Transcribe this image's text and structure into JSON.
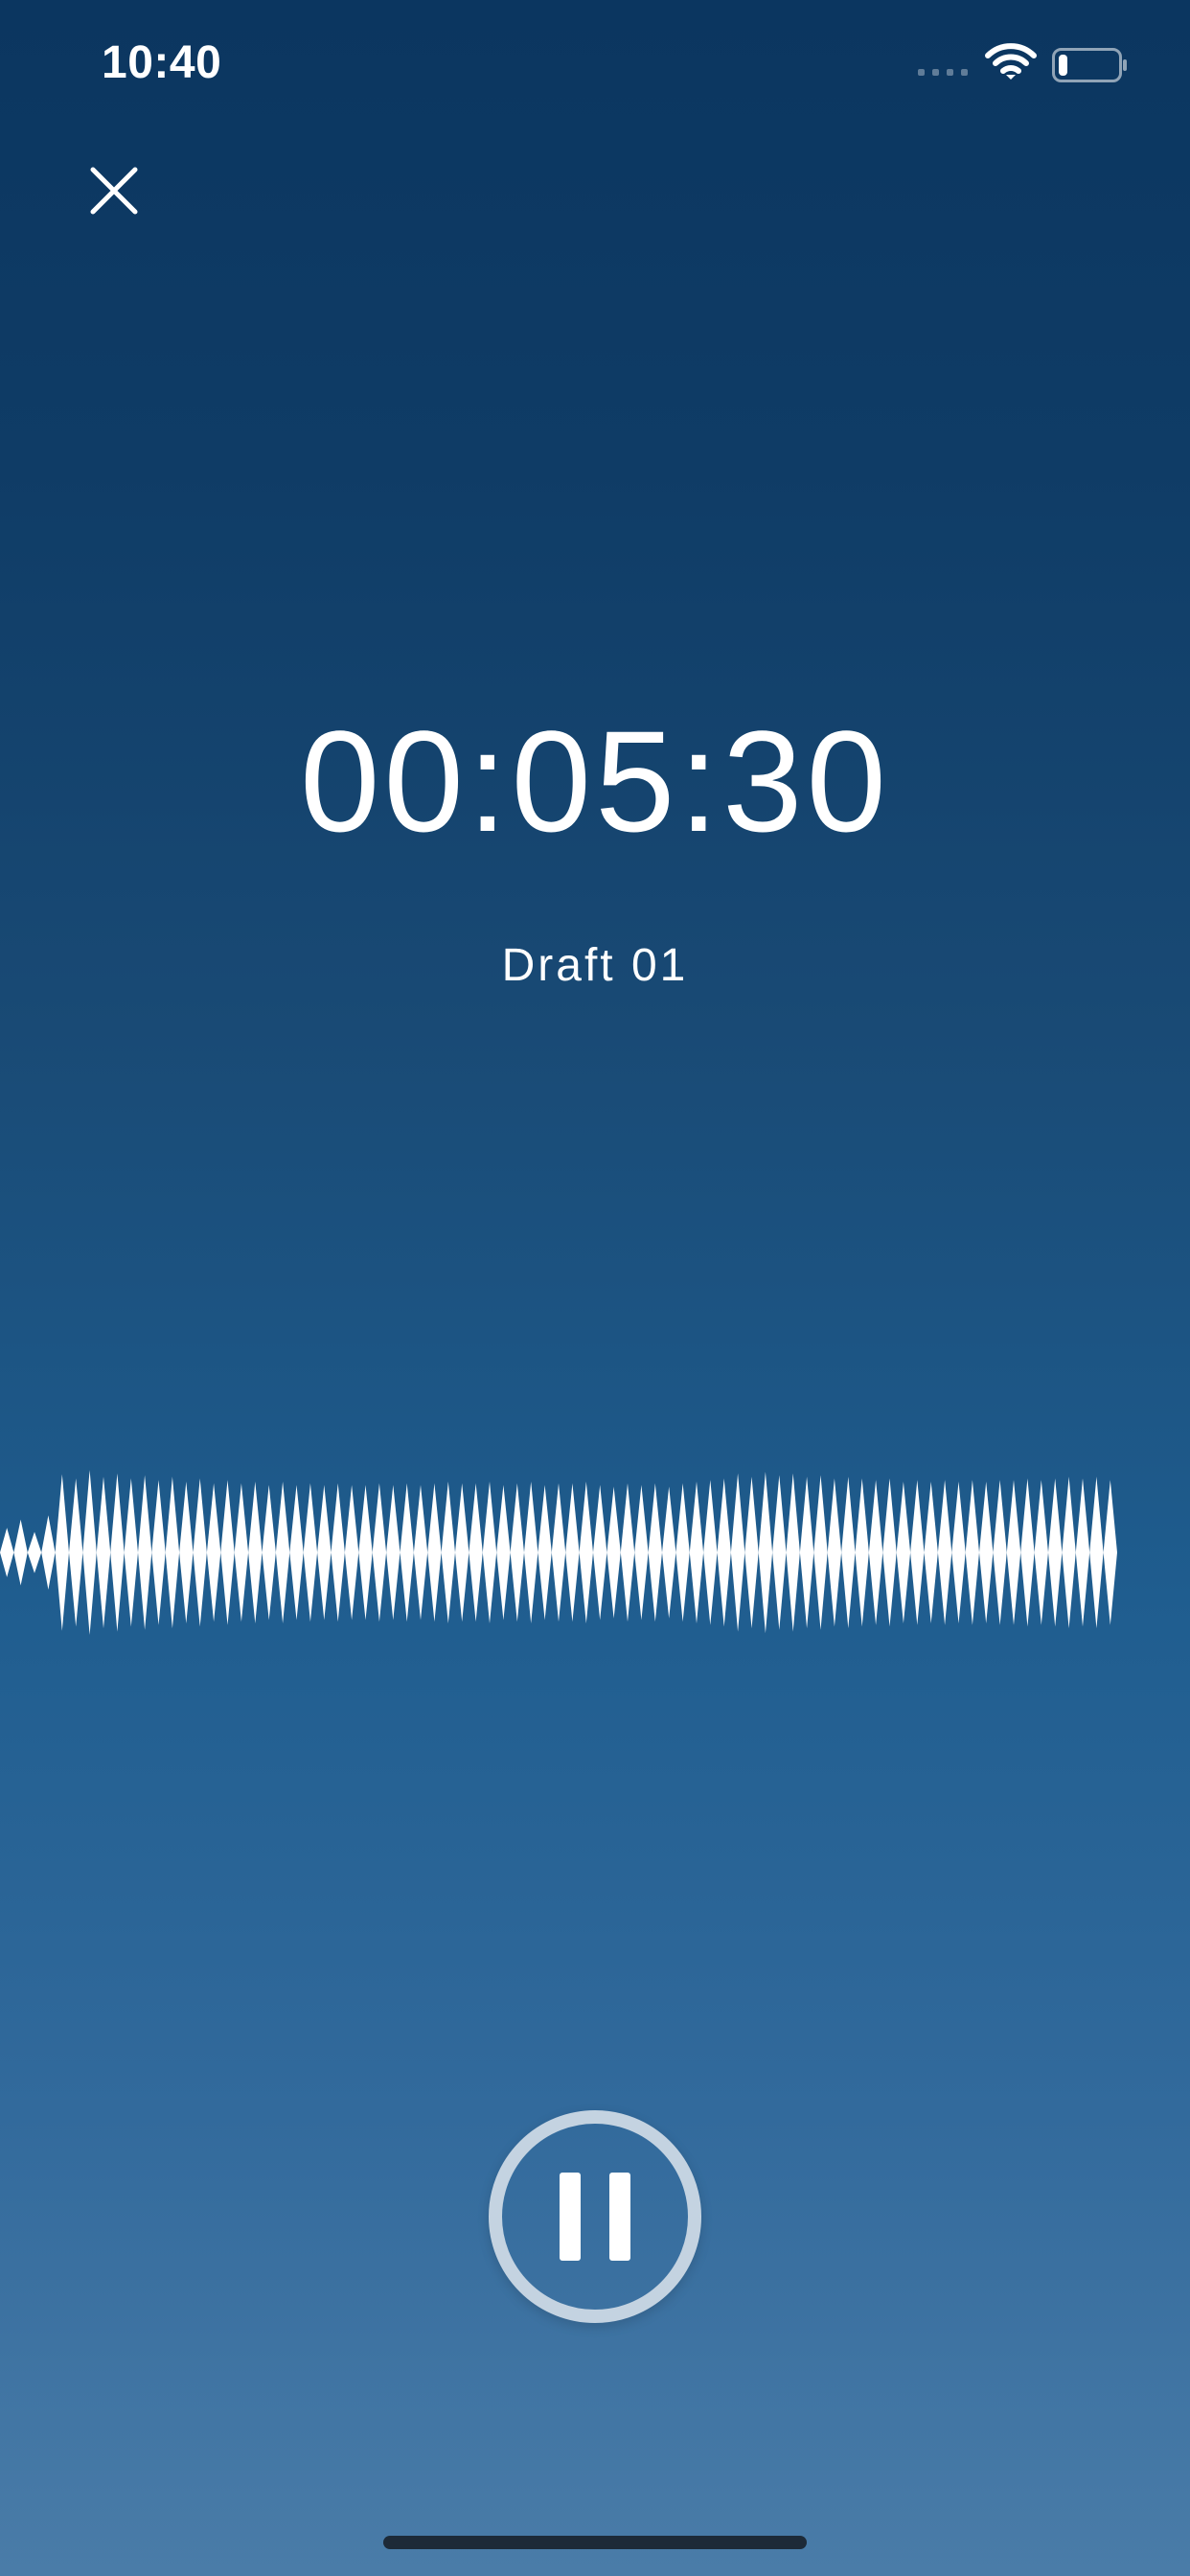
{
  "status_bar": {
    "time": "10:40",
    "icons": [
      "cellular-signal-icon",
      "wifi-icon",
      "battery-icon"
    ],
    "battery_level": 0.15
  },
  "toolbar": {
    "close_icon": "close-icon"
  },
  "recording": {
    "elapsed_time": "00:05:30",
    "title": "Draft 01",
    "state": "recording",
    "waveform_amplitudes": [
      0.3,
      0.4,
      0.25,
      0.45,
      0.95,
      0.9,
      1.0,
      0.92,
      0.96,
      0.9,
      0.94,
      0.88,
      0.92,
      0.86,
      0.9,
      0.84,
      0.88,
      0.84,
      0.86,
      0.82,
      0.86,
      0.82,
      0.84,
      0.82,
      0.84,
      0.82,
      0.82,
      0.84,
      0.82,
      0.84,
      0.82,
      0.84,
      0.86,
      0.84,
      0.84,
      0.86,
      0.82,
      0.84,
      0.86,
      0.82,
      0.84,
      0.84,
      0.86,
      0.82,
      0.8,
      0.84,
      0.82,
      0.84,
      0.8,
      0.84,
      0.86,
      0.88,
      0.9,
      0.96,
      0.92,
      0.98,
      0.94,
      0.96,
      0.92,
      0.94,
      0.9,
      0.92,
      0.9,
      0.88,
      0.9,
      0.86,
      0.88,
      0.86,
      0.88,
      0.86,
      0.88,
      0.86,
      0.88,
      0.88,
      0.9,
      0.88,
      0.9,
      0.92,
      0.9,
      0.92,
      0.88
    ]
  },
  "controls": {
    "pause_icon": "pause-icon"
  },
  "colors": {
    "background_top": "#0b3660",
    "background_bottom": "#4a7ca8",
    "foreground": "#ffffff",
    "pause_ring": "#c4d3e1",
    "home_indicator": "#1d2a38"
  }
}
